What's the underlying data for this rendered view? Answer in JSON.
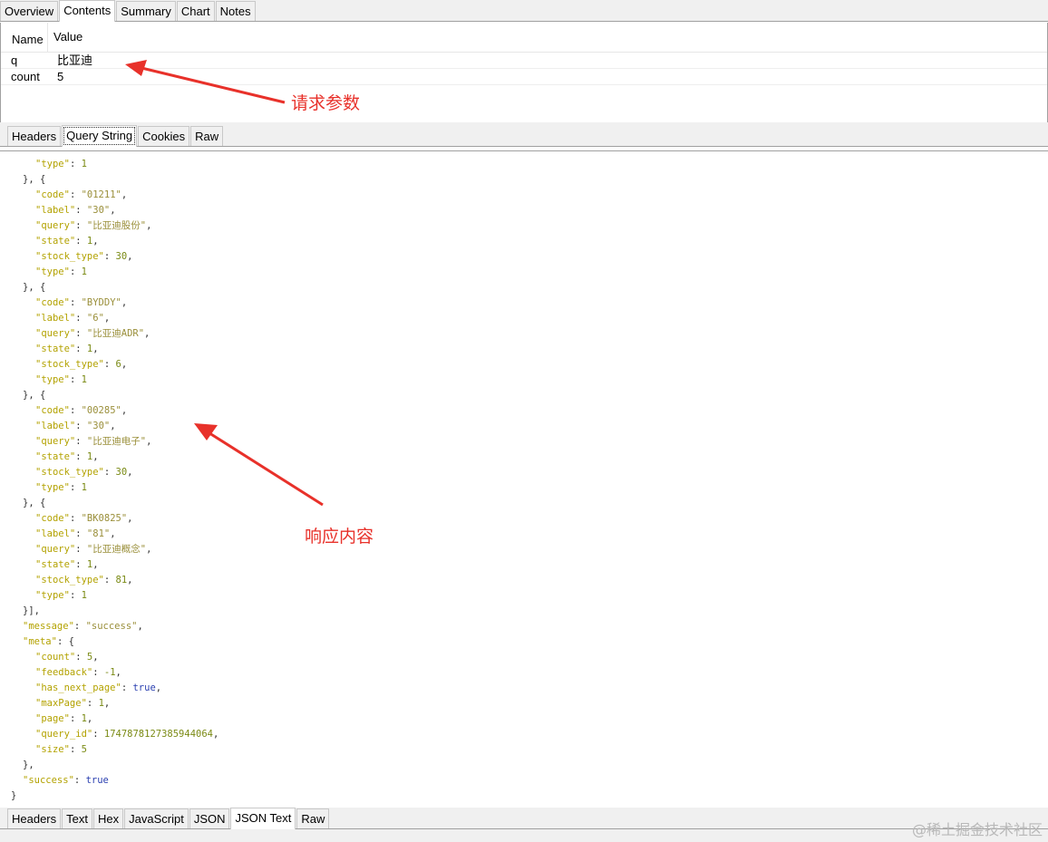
{
  "top_tabs": [
    "Overview",
    "Contents",
    "Summary",
    "Chart",
    "Notes"
  ],
  "query_string": {
    "headers": {
      "name": "Name",
      "value": "Value"
    },
    "rows": [
      {
        "name": "q",
        "value": "比亚迪"
      },
      {
        "name": "count",
        "value": "5"
      }
    ]
  },
  "request_tabs": [
    "Headers",
    "Query String",
    "Cookies",
    "Raw"
  ],
  "response_tabs": [
    "Headers",
    "Text",
    "Hex",
    "JavaScript",
    "JSON",
    "JSON Text",
    "Raw"
  ],
  "annotations": {
    "request_params": "请求参数",
    "response_content": "响应内容"
  },
  "watermark": "@稀土掘金技术社区",
  "json_lines": [
    {
      "indent": 2,
      "parts": [
        [
          "k",
          "\"type\""
        ],
        [
          "p",
          ": "
        ],
        [
          "n",
          "1"
        ]
      ]
    },
    {
      "indent": 1,
      "parts": [
        [
          "p",
          "}, {"
        ]
      ]
    },
    {
      "indent": 2,
      "parts": [
        [
          "k",
          "\"code\""
        ],
        [
          "p",
          ": "
        ],
        [
          "s",
          "\"01211\""
        ],
        [
          "p",
          ","
        ]
      ]
    },
    {
      "indent": 2,
      "parts": [
        [
          "k",
          "\"label\""
        ],
        [
          "p",
          ": "
        ],
        [
          "s",
          "\"30\""
        ],
        [
          "p",
          ","
        ]
      ]
    },
    {
      "indent": 2,
      "parts": [
        [
          "k",
          "\"query\""
        ],
        [
          "p",
          ": "
        ],
        [
          "s",
          "\"比亚迪股份\""
        ],
        [
          "p",
          ","
        ]
      ]
    },
    {
      "indent": 2,
      "parts": [
        [
          "k",
          "\"state\""
        ],
        [
          "p",
          ": "
        ],
        [
          "n",
          "1"
        ],
        [
          "p",
          ","
        ]
      ]
    },
    {
      "indent": 2,
      "parts": [
        [
          "k",
          "\"stock_type\""
        ],
        [
          "p",
          ": "
        ],
        [
          "n",
          "30"
        ],
        [
          "p",
          ","
        ]
      ]
    },
    {
      "indent": 2,
      "parts": [
        [
          "k",
          "\"type\""
        ],
        [
          "p",
          ": "
        ],
        [
          "n",
          "1"
        ]
      ]
    },
    {
      "indent": 1,
      "parts": [
        [
          "p",
          "}, {"
        ]
      ]
    },
    {
      "indent": 2,
      "parts": [
        [
          "k",
          "\"code\""
        ],
        [
          "p",
          ": "
        ],
        [
          "s",
          "\"BYDDY\""
        ],
        [
          "p",
          ","
        ]
      ]
    },
    {
      "indent": 2,
      "parts": [
        [
          "k",
          "\"label\""
        ],
        [
          "p",
          ": "
        ],
        [
          "s",
          "\"6\""
        ],
        [
          "p",
          ","
        ]
      ]
    },
    {
      "indent": 2,
      "parts": [
        [
          "k",
          "\"query\""
        ],
        [
          "p",
          ": "
        ],
        [
          "s",
          "\"比亚迪ADR\""
        ],
        [
          "p",
          ","
        ]
      ]
    },
    {
      "indent": 2,
      "parts": [
        [
          "k",
          "\"state\""
        ],
        [
          "p",
          ": "
        ],
        [
          "n",
          "1"
        ],
        [
          "p",
          ","
        ]
      ]
    },
    {
      "indent": 2,
      "parts": [
        [
          "k",
          "\"stock_type\""
        ],
        [
          "p",
          ": "
        ],
        [
          "n",
          "6"
        ],
        [
          "p",
          ","
        ]
      ]
    },
    {
      "indent": 2,
      "parts": [
        [
          "k",
          "\"type\""
        ],
        [
          "p",
          ": "
        ],
        [
          "n",
          "1"
        ]
      ]
    },
    {
      "indent": 1,
      "parts": [
        [
          "p",
          "}, {"
        ]
      ]
    },
    {
      "indent": 2,
      "parts": [
        [
          "k",
          "\"code\""
        ],
        [
          "p",
          ": "
        ],
        [
          "s",
          "\"00285\""
        ],
        [
          "p",
          ","
        ]
      ]
    },
    {
      "indent": 2,
      "parts": [
        [
          "k",
          "\"label\""
        ],
        [
          "p",
          ": "
        ],
        [
          "s",
          "\"30\""
        ],
        [
          "p",
          ","
        ]
      ]
    },
    {
      "indent": 2,
      "parts": [
        [
          "k",
          "\"query\""
        ],
        [
          "p",
          ": "
        ],
        [
          "s",
          "\"比亚迪电子\""
        ],
        [
          "p",
          ","
        ]
      ]
    },
    {
      "indent": 2,
      "parts": [
        [
          "k",
          "\"state\""
        ],
        [
          "p",
          ": "
        ],
        [
          "n",
          "1"
        ],
        [
          "p",
          ","
        ]
      ]
    },
    {
      "indent": 2,
      "parts": [
        [
          "k",
          "\"stock_type\""
        ],
        [
          "p",
          ": "
        ],
        [
          "n",
          "30"
        ],
        [
          "p",
          ","
        ]
      ]
    },
    {
      "indent": 2,
      "parts": [
        [
          "k",
          "\"type\""
        ],
        [
          "p",
          ": "
        ],
        [
          "n",
          "1"
        ]
      ]
    },
    {
      "indent": 1,
      "parts": [
        [
          "p",
          "}, {"
        ]
      ]
    },
    {
      "indent": 2,
      "parts": [
        [
          "k",
          "\"code\""
        ],
        [
          "p",
          ": "
        ],
        [
          "s",
          "\"BK0825\""
        ],
        [
          "p",
          ","
        ]
      ]
    },
    {
      "indent": 2,
      "parts": [
        [
          "k",
          "\"label\""
        ],
        [
          "p",
          ": "
        ],
        [
          "s",
          "\"81\""
        ],
        [
          "p",
          ","
        ]
      ]
    },
    {
      "indent": 2,
      "parts": [
        [
          "k",
          "\"query\""
        ],
        [
          "p",
          ": "
        ],
        [
          "s",
          "\"比亚迪概念\""
        ],
        [
          "p",
          ","
        ]
      ]
    },
    {
      "indent": 2,
      "parts": [
        [
          "k",
          "\"state\""
        ],
        [
          "p",
          ": "
        ],
        [
          "n",
          "1"
        ],
        [
          "p",
          ","
        ]
      ]
    },
    {
      "indent": 2,
      "parts": [
        [
          "k",
          "\"stock_type\""
        ],
        [
          "p",
          ": "
        ],
        [
          "n",
          "81"
        ],
        [
          "p",
          ","
        ]
      ]
    },
    {
      "indent": 2,
      "parts": [
        [
          "k",
          "\"type\""
        ],
        [
          "p",
          ": "
        ],
        [
          "n",
          "1"
        ]
      ]
    },
    {
      "indent": 1,
      "parts": [
        [
          "p",
          "}],"
        ]
      ]
    },
    {
      "indent": 1,
      "parts": [
        [
          "k",
          "\"message\""
        ],
        [
          "p",
          ": "
        ],
        [
          "s",
          "\"success\""
        ],
        [
          "p",
          ","
        ]
      ]
    },
    {
      "indent": 1,
      "parts": [
        [
          "k",
          "\"meta\""
        ],
        [
          "p",
          ": {"
        ]
      ]
    },
    {
      "indent": 2,
      "parts": [
        [
          "k",
          "\"count\""
        ],
        [
          "p",
          ": "
        ],
        [
          "n",
          "5"
        ],
        [
          "p",
          ","
        ]
      ]
    },
    {
      "indent": 2,
      "parts": [
        [
          "k",
          "\"feedback\""
        ],
        [
          "p",
          ": "
        ],
        [
          "n",
          "-1"
        ],
        [
          "p",
          ","
        ]
      ]
    },
    {
      "indent": 2,
      "parts": [
        [
          "k",
          "\"has_next_page\""
        ],
        [
          "p",
          ": "
        ],
        [
          "b",
          "true"
        ],
        [
          "p",
          ","
        ]
      ]
    },
    {
      "indent": 2,
      "parts": [
        [
          "k",
          "\"maxPage\""
        ],
        [
          "p",
          ": "
        ],
        [
          "n",
          "1"
        ],
        [
          "p",
          ","
        ]
      ]
    },
    {
      "indent": 2,
      "parts": [
        [
          "k",
          "\"page\""
        ],
        [
          "p",
          ": "
        ],
        [
          "n",
          "1"
        ],
        [
          "p",
          ","
        ]
      ]
    },
    {
      "indent": 2,
      "parts": [
        [
          "k",
          "\"query_id\""
        ],
        [
          "p",
          ": "
        ],
        [
          "n",
          "1747878127385944064"
        ],
        [
          "p",
          ","
        ]
      ]
    },
    {
      "indent": 2,
      "parts": [
        [
          "k",
          "\"size\""
        ],
        [
          "p",
          ": "
        ],
        [
          "n",
          "5"
        ]
      ]
    },
    {
      "indent": 1,
      "parts": [
        [
          "p",
          "},"
        ]
      ]
    },
    {
      "indent": 1,
      "parts": [
        [
          "k",
          "\"success\""
        ],
        [
          "p",
          ": "
        ],
        [
          "b",
          "true"
        ]
      ]
    },
    {
      "indent": 0,
      "parts": [
        [
          "p",
          "}"
        ]
      ]
    }
  ]
}
